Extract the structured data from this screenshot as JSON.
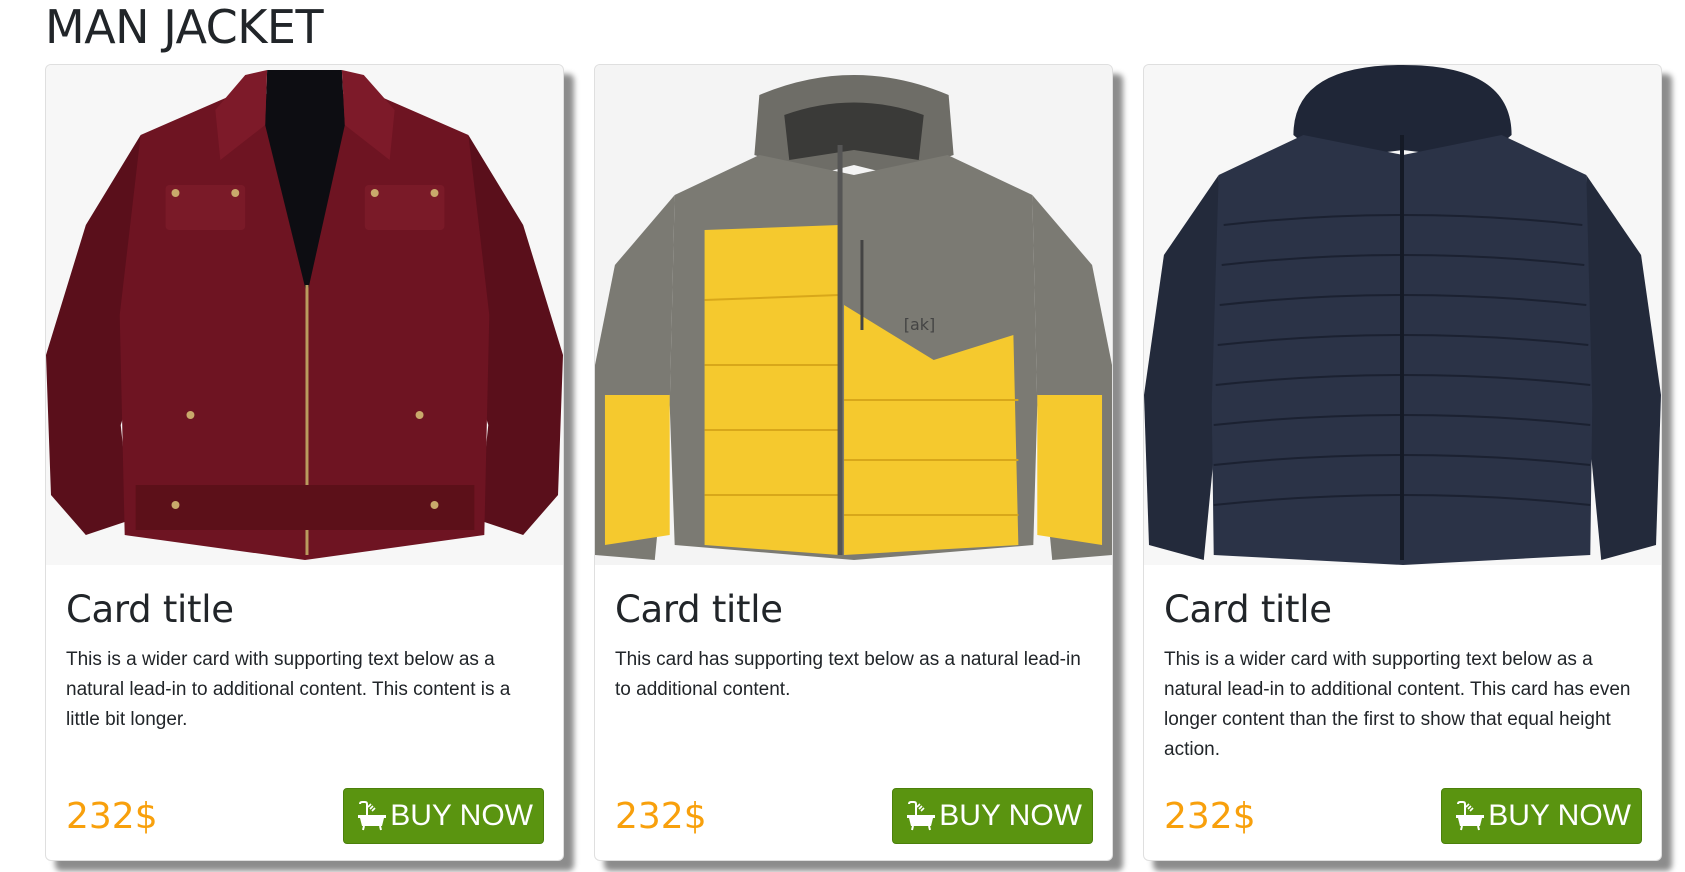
{
  "page": {
    "title": "MAN JACKET"
  },
  "products": [
    {
      "image_icon": "maroon-leather-jacket",
      "title": "Card title",
      "text": "This is a wider card with supporting text below as a natural lead-in to additional content. This content is a little bit longer.",
      "price": "232$",
      "button_label": "BUY NOW"
    },
    {
      "image_icon": "yellow-grey-puffer-jacket",
      "title": "Card title",
      "text": "This card has supporting text below as a natural lead-in to additional content.",
      "price": "232$",
      "button_label": "BUY NOW"
    },
    {
      "image_icon": "navy-puffer-jacket",
      "title": "Card title",
      "text": "This is a wider card with supporting text below as a natural lead-in to additional content. This card has even longer content than the first to show that equal height action.",
      "price": "232$",
      "button_label": "BUY NOW"
    }
  ],
  "colors": {
    "price": "#f8a00c",
    "button": "#5a9410",
    "jacket_maroon": "#6e1422",
    "jacket_yellow": "#f5c92e",
    "jacket_grey": "#7b7a73",
    "jacket_navy": "#2b3347"
  }
}
